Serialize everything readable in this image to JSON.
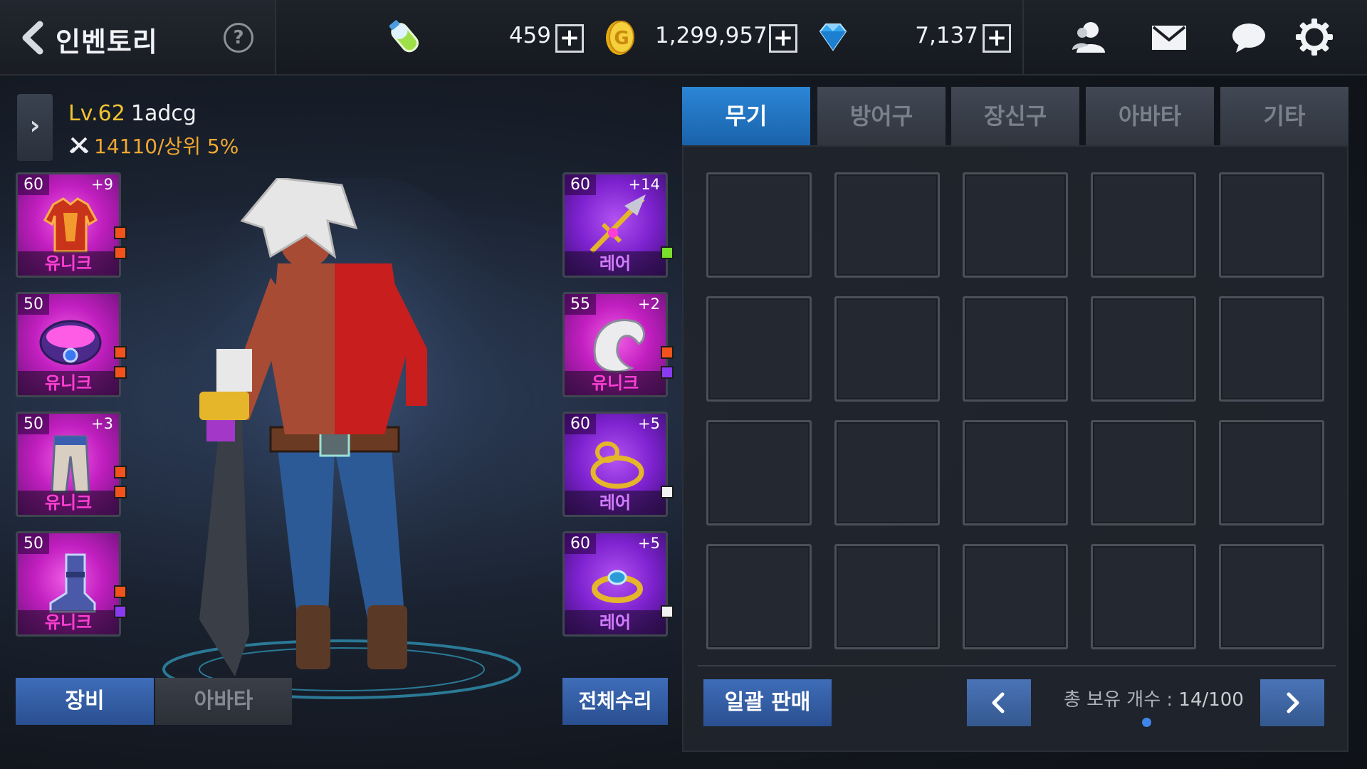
{
  "header": {
    "title": "인벤토리",
    "help_label": "?",
    "stamina": "459",
    "gold": "1,299,957",
    "gems": "7,137",
    "plus_label": "+"
  },
  "character": {
    "level": "Lv.62",
    "name": "1adcg",
    "power_rank": "14110/상위 5%"
  },
  "left_slots": [
    {
      "level": "60",
      "enhance": "+9",
      "grade": "유니크",
      "item": "armor"
    },
    {
      "level": "50",
      "enhance": "",
      "grade": "유니크",
      "item": "belt"
    },
    {
      "level": "50",
      "enhance": "+3",
      "grade": "유니크",
      "item": "pants"
    },
    {
      "level": "50",
      "enhance": "",
      "grade": "유니크",
      "item": "boots"
    }
  ],
  "right_slots": [
    {
      "level": "60",
      "enhance": "+14",
      "grade": "레어",
      "item": "weapon"
    },
    {
      "level": "55",
      "enhance": "+2",
      "grade": "유니크",
      "item": "shoulder-guard"
    },
    {
      "level": "60",
      "enhance": "+5",
      "grade": "레어",
      "item": "necklace"
    },
    {
      "level": "60",
      "enhance": "+5",
      "grade": "레어",
      "item": "ring"
    }
  ],
  "equip_tabs": [
    "장비",
    "아바타"
  ],
  "repair_all": "전체수리",
  "inventory": {
    "tabs": [
      "무기",
      "방어구",
      "장신구",
      "아바타",
      "기타"
    ],
    "active_tab": "무기",
    "bulk_sell": "일괄 판매",
    "count_label": "총 보유 개수 :",
    "count_value": "14/100"
  },
  "colors": {
    "accent_blue": "#2b86d6",
    "unique_magenta": "#c21fc0",
    "rare_purple": "#7d22cf",
    "level_yellow": "#f2c230",
    "power_orange": "#f0a830"
  },
  "icons": [
    "back-arrow-icon",
    "help-icon",
    "stamina-potion-icon",
    "gold-coin-icon",
    "diamond-icon",
    "friends-icon",
    "mail-icon",
    "chat-icon",
    "settings-gear-icon",
    "crossed-swords-icon",
    "chevron-right-icon",
    "chevron-left-icon"
  ]
}
